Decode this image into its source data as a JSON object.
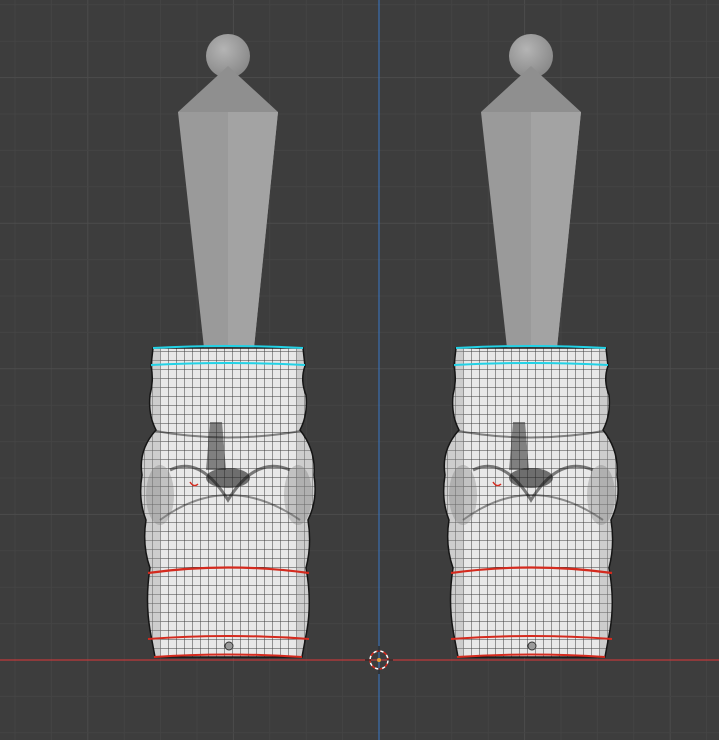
{
  "viewport": {
    "background": "#3d3d3d",
    "grid_minor_color": "#444444",
    "grid_major_color": "#4c4c4c",
    "x_axis_color": "#c0393b",
    "y_axis_color": "#3a6fb0",
    "mesh_fill": "#e6e6e6",
    "wire_color": "#1a1a1a",
    "handle_color": "#9d9d9d",
    "seam_top_color": "#22d2e6",
    "seam_bottom_color": "#d42a1e",
    "cursor_icon": "3d-cursor-icon",
    "objects": [
      "left-model",
      "right-model"
    ]
  }
}
